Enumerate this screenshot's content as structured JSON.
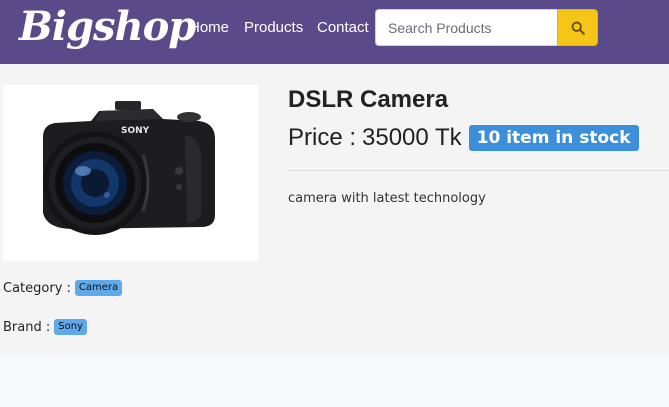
{
  "nav": {
    "brand": "Bigshop",
    "links": [
      {
        "label": "Home"
      },
      {
        "label": "Products"
      },
      {
        "label": "Contact"
      }
    ],
    "search": {
      "placeholder": "Search Products",
      "value": ""
    },
    "search_icon": "search-icon"
  },
  "product": {
    "title": "DSLR Camera",
    "price_label": "Price :",
    "price_value": "35000 Tk",
    "stock_badge": "10 item in stock",
    "description": "camera with latest technology",
    "image_icon": "camera-icon",
    "category_label": "Category :",
    "category_value": "Camera",
    "brand_label": "Brand :",
    "brand_value": "Sony"
  },
  "colors": {
    "navbar": "#5b4a8a",
    "search_button": "#f5c518",
    "stock_badge": "#3d8fd9",
    "tag": "#5fa9ea"
  }
}
